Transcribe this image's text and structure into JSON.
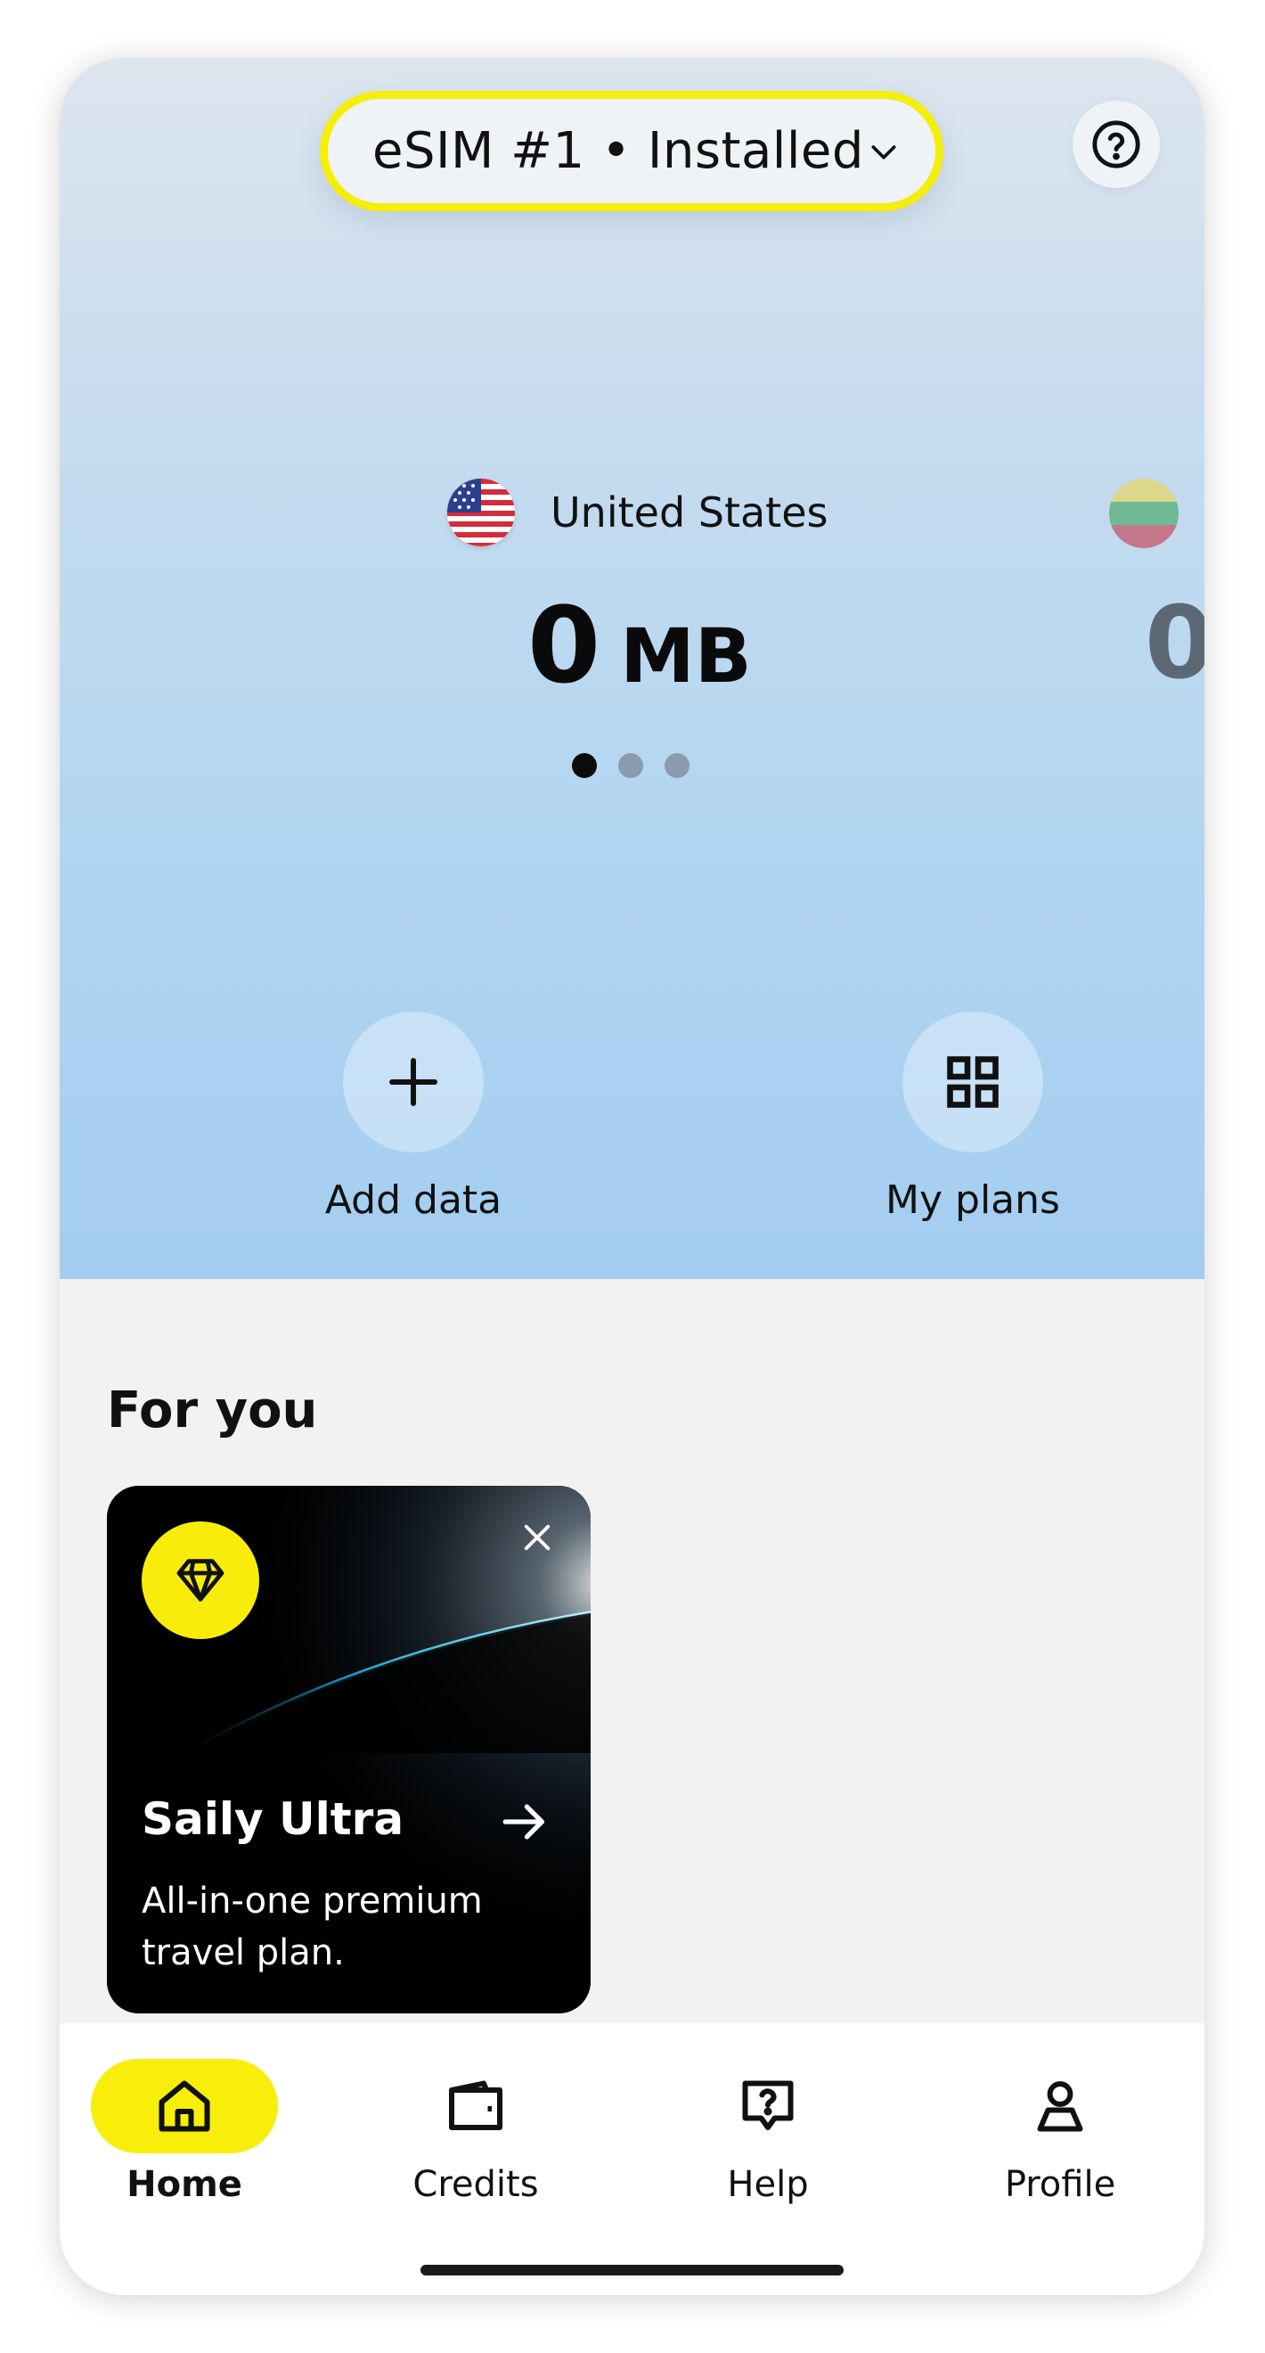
{
  "esim_selector": {
    "label": "eSIM #1 • Installed",
    "icon": "chevron-down-icon"
  },
  "help_button": {
    "icon": "question-circle-icon"
  },
  "plan_carousel": {
    "active": {
      "country": "United States",
      "flag": "us-flag-icon",
      "amount": "0",
      "unit": "MB"
    },
    "next_peek": {
      "flag": "lithuania-flag-icon",
      "amount": "0"
    },
    "pages": 3,
    "current_page": 1
  },
  "actions": [
    {
      "label": "Add data",
      "icon": "plus-icon"
    },
    {
      "label": "My plans",
      "icon": "grid-icon"
    }
  ],
  "for_you": {
    "title": "For you",
    "card": {
      "title": "Saily Ultra",
      "description": "All-in-one premium travel plan.",
      "badge_icon": "diamond-icon",
      "close_icon": "close-icon",
      "arrow_icon": "arrow-right-icon"
    }
  },
  "bottom_nav": [
    {
      "label": "Home",
      "icon": "home-icon",
      "active": true
    },
    {
      "label": "Credits",
      "icon": "wallet-icon",
      "active": false
    },
    {
      "label": "Help",
      "icon": "help-chat-icon",
      "active": false
    },
    {
      "label": "Profile",
      "icon": "person-icon",
      "active": false
    }
  ],
  "colors": {
    "accent_yellow": "#f7ef0a",
    "hero_top": "#dde6ef",
    "hero_bottom": "#a3cdf0",
    "page_background": "#f2f2f2"
  }
}
